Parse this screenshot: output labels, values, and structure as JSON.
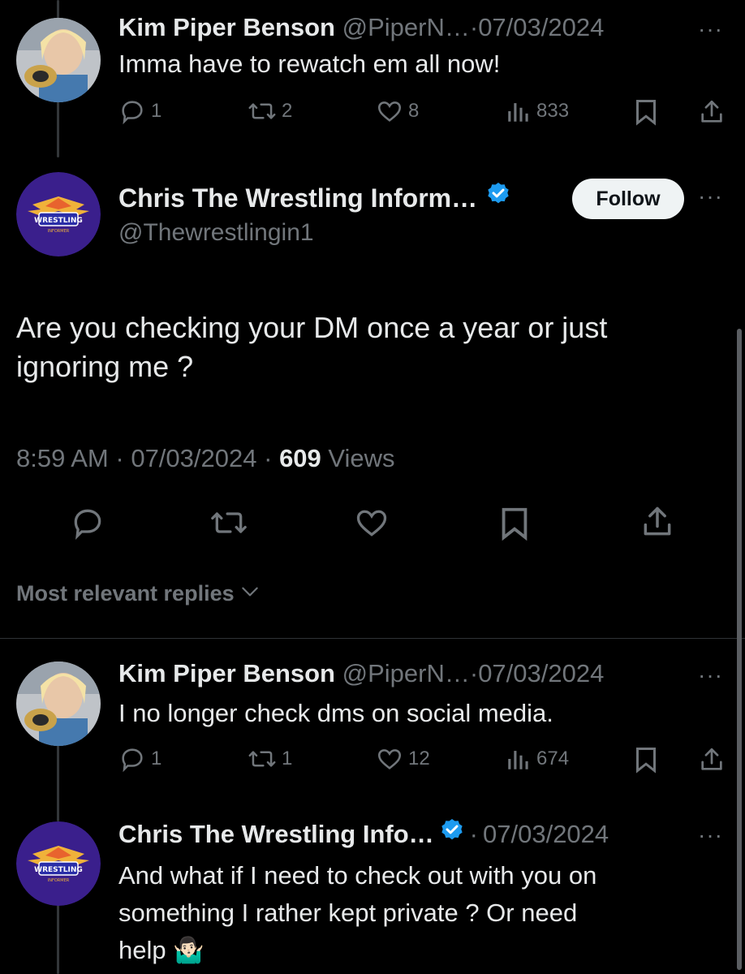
{
  "tweets": [
    {
      "author": "Kim Piper Benson",
      "handle": "@PiperN…",
      "separator": "·",
      "date": "07/03/2024",
      "text": "Imma have to rewatch em all now!",
      "replies": "1",
      "retweets": "2",
      "likes": "8",
      "views": "833"
    },
    {
      "author": "Kim Piper Benson",
      "handle": "@PiperN…",
      "separator": "·",
      "date": "07/03/2024",
      "text": "I no longer check dms on social media.",
      "replies": "1",
      "retweets": "1",
      "likes": "12",
      "views": "674"
    },
    {
      "author": "Chris The Wrestling Info…",
      "separator": "·",
      "date": "07/03/2024",
      "text_line1": "And what if I need to check out with you on",
      "text_line2": "something I rather kept private ? Or need",
      "text_line3": "help 🤷🏻‍♂️"
    }
  ],
  "main_tweet": {
    "author": "Chris The Wrestling Inform…",
    "handle": "@Thewrestlingin1",
    "follow_label": "Follow",
    "text_line1": "Are you checking your DM once a year or just",
    "text_line2": "ignoring me ?",
    "time": "8:59 AM",
    "sep1": "·",
    "date": "07/03/2024",
    "sep2": "·",
    "views_count": "609",
    "views_label": "Views"
  },
  "replies_sort": {
    "label": "Most relevant replies"
  },
  "colors": {
    "background": "#000000",
    "text": "#e7e9ea",
    "muted": "#71767b",
    "verified": "#1d9bf0",
    "follow_bg": "#eff3f4"
  },
  "icons": [
    "reply-icon",
    "retweet-icon",
    "like-icon",
    "views-icon",
    "bookmark-icon",
    "share-icon",
    "verified-icon",
    "more-icon",
    "chevron-down-icon"
  ]
}
